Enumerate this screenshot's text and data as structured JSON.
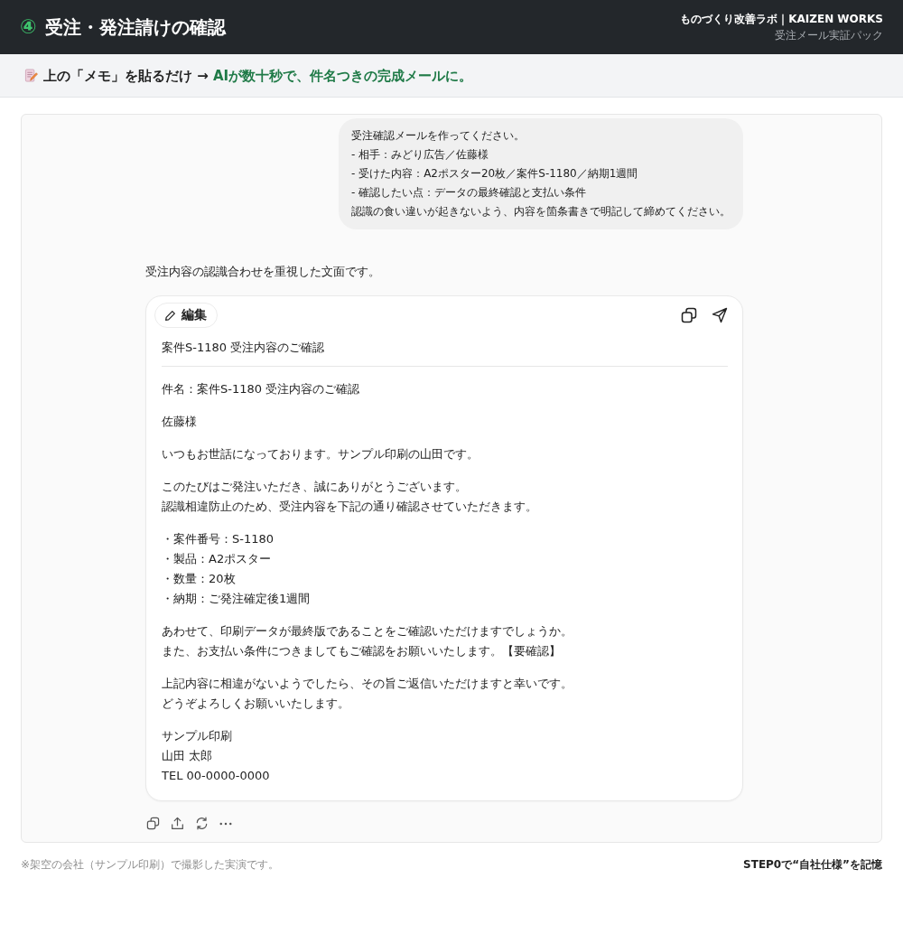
{
  "header": {
    "step": "④",
    "title": "受注・発注請けの確認",
    "brand": "ものづくり改善ラボ｜KAIZEN WORKS",
    "subtitle": "受注メール実証パック"
  },
  "banner": {
    "lead": "上の「メモ」を貼るだけ →",
    "highlight": "AIが数十秒で、件名つきの完成メールに。"
  },
  "chat": {
    "user_message": [
      "受注確認メールを作ってください。",
      "- 相手：みどり広告／佐藤様",
      "- 受けた内容：A2ポスター20枚／案件S-1180／納期1週間",
      "- 確認したい点：データの最終確認と支払い条件",
      "認識の食い違いが起きないよう、内容を箇条書きで明記して締めてください。"
    ],
    "assistant_intro": "受注内容の認識合わせを重視した文面です。",
    "draft": {
      "edit_button": "編集",
      "subject": "案件S-1180 受注内容のご確認",
      "body": [
        [
          "件名：案件S-1180 受注内容のご確認"
        ],
        [
          "佐藤様"
        ],
        [
          "いつもお世話になっております。サンプル印刷の山田です。"
        ],
        [
          "このたびはご発注いただき、誠にありがとうございます。",
          "認識相違防止のため、受注内容を下記の通り確認させていただきます。"
        ],
        [
          "・案件番号：S-1180",
          "・製品：A2ポスター",
          "・数量：20枚",
          "・納期：ご発注確定後1週間"
        ],
        [
          "あわせて、印刷データが最終版であることをご確認いただけますでしょうか。",
          "また、お支払い条件につきましてもご確認をお願いいたします。【要確認】"
        ],
        [
          "上記内容に相違がないようでしたら、その旨ご返信いただけますと幸いです。",
          "どうぞよろしくお願いいたします。"
        ],
        [
          "サンプル印刷",
          "山田 太郎",
          "TEL 00-0000-0000"
        ]
      ]
    }
  },
  "footer": {
    "note": "※架空の会社（サンプル印刷）で撮影した実演です。",
    "step_note": "STEP0で“自社仕様”を記憶"
  }
}
